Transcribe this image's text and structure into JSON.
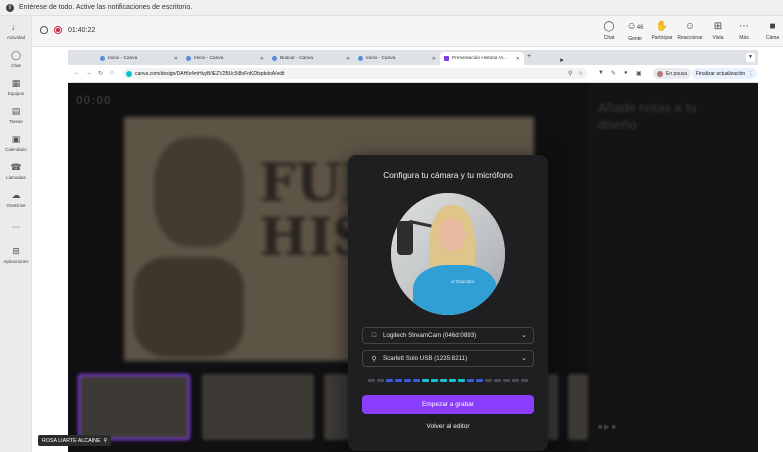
{
  "notification": {
    "text": "Entérese de todo. Active las notificaciones de escritorio."
  },
  "rail": {
    "items": [
      {
        "label": "Actividad",
        "icon": "bell-icon"
      },
      {
        "label": "Chat",
        "icon": "chat-icon"
      },
      {
        "label": "Equipos",
        "icon": "teams-icon"
      },
      {
        "label": "Tareas",
        "icon": "tasks-icon"
      },
      {
        "label": "Calendario",
        "icon": "calendar-icon"
      },
      {
        "label": "Llamadas",
        "icon": "phone-icon"
      },
      {
        "label": "OneDrive",
        "icon": "cloud-icon"
      },
      {
        "label": "",
        "icon": "more-icon"
      },
      {
        "label": "Aplicaciones",
        "icon": "apps-icon"
      }
    ]
  },
  "meeting": {
    "timer": "01:40:22",
    "buttons": {
      "chat": "Chat",
      "people": "Gente",
      "people_count": "46",
      "raise": "Participar",
      "react": "Reaccionar",
      "view": "Vista",
      "more": "Más",
      "camera": "Cáma"
    }
  },
  "browser": {
    "tabs": [
      {
        "label": "Inicio - Canva"
      },
      {
        "label": "Inicio - Canva"
      },
      {
        "label": "Buscar - Canva"
      },
      {
        "label": "Inicio - Canva"
      },
      {
        "label": "Presentación Historia Vi..."
      }
    ],
    "url": "canva.com/design/DAHIz4mHuyB/iEZV2BUc5i8oFnKDfspkdoA/edit",
    "paused": "En pausa",
    "update": "Finalizar actualización"
  },
  "canva": {
    "timer": "00:00",
    "slide_title": "FUE\nHISTO",
    "right_text": "Añade notas a tu diseño"
  },
  "modal": {
    "title": "Configura tu cámara y tu micrófono",
    "shirt_text": "or Educator",
    "camera_device": "Logitech StreamCam (046d:0893)",
    "mic_device": "Scarlett Solo USB (1235:8211)",
    "mic_level": 0.62,
    "record_button": "Empezar a grabar",
    "back_link": "Volver al editor"
  },
  "participant": {
    "name": "ROSA LIARTE ALCAINE"
  },
  "colors": {
    "accent": "#8b3dff",
    "recording": "#c4314b"
  }
}
